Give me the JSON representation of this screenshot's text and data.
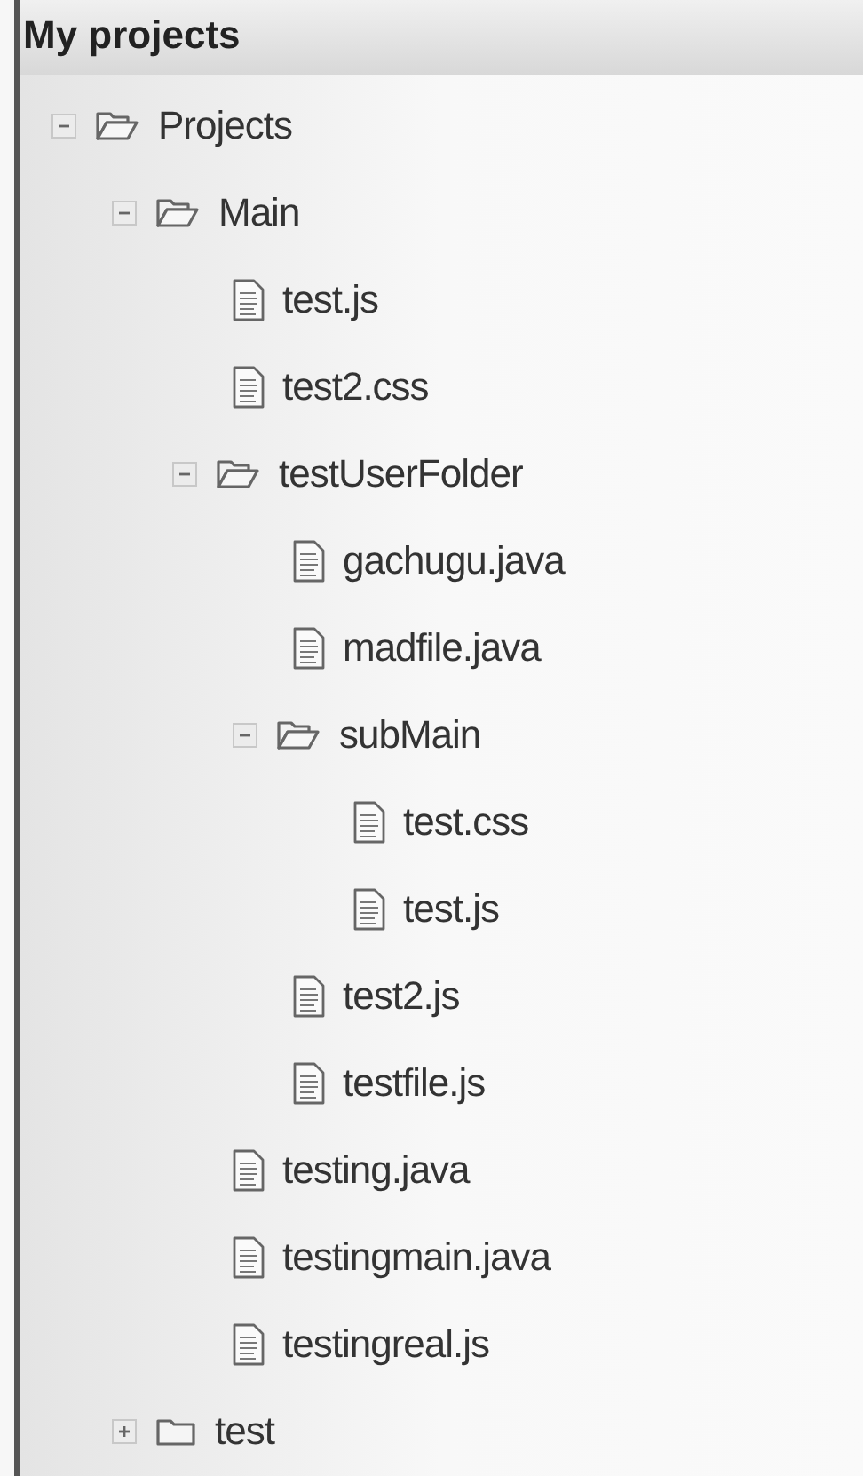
{
  "panel": {
    "title": "My projects"
  },
  "tree": [
    {
      "kind": "folder",
      "label": "Projects",
      "expanded": true,
      "children": [
        {
          "kind": "folder",
          "label": "Main",
          "expanded": true,
          "children": [
            {
              "kind": "file",
              "label": "test.js"
            },
            {
              "kind": "file",
              "label": "test2.css"
            },
            {
              "kind": "folder",
              "label": "testUserFolder",
              "expanded": true,
              "children": [
                {
                  "kind": "file",
                  "label": "gachugu.java"
                },
                {
                  "kind": "file",
                  "label": "madfile.java"
                },
                {
                  "kind": "folder",
                  "label": "subMain",
                  "expanded": true,
                  "children": [
                    {
                      "kind": "file",
                      "label": "test.css"
                    },
                    {
                      "kind": "file",
                      "label": "test.js"
                    }
                  ]
                },
                {
                  "kind": "file",
                  "label": "test2.js"
                },
                {
                  "kind": "file",
                  "label": "testfile.js"
                }
              ]
            },
            {
              "kind": "file",
              "label": "testing.java"
            },
            {
              "kind": "file",
              "label": "testingmain.java"
            },
            {
              "kind": "file",
              "label": "testingreal.js"
            }
          ]
        },
        {
          "kind": "folder",
          "label": "test",
          "expanded": false
        }
      ]
    }
  ]
}
